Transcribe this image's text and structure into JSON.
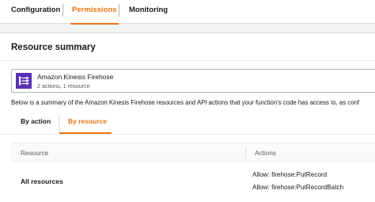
{
  "top_tabs": [
    {
      "label": "Configuration",
      "active": false
    },
    {
      "label": "Permissions",
      "active": true
    },
    {
      "label": "Monitoring",
      "active": false
    }
  ],
  "panel": {
    "title": "Resource summary",
    "service": {
      "icon": "kinesis-firehose-icon",
      "name": "Amazon Kinesis Firehose",
      "meta": "2 actions, 1 resource"
    },
    "summary_text": "Below is a summary of the Amazon Kinesis Firehose resources and API actions that your function's code has access to, as conf",
    "inner_tabs": [
      {
        "label": "By action",
        "active": false
      },
      {
        "label": "By resource",
        "active": true
      }
    ],
    "table": {
      "headers": [
        "Resource",
        "Actions"
      ],
      "rows": [
        {
          "resource": "All resources",
          "actions": [
            "Allow: firehose:PutRecord",
            "Allow: firehose:PutRecordBatch"
          ]
        }
      ]
    }
  },
  "colors": {
    "accent": "#ec7211",
    "service_icon_bg": "#5a30b5"
  }
}
